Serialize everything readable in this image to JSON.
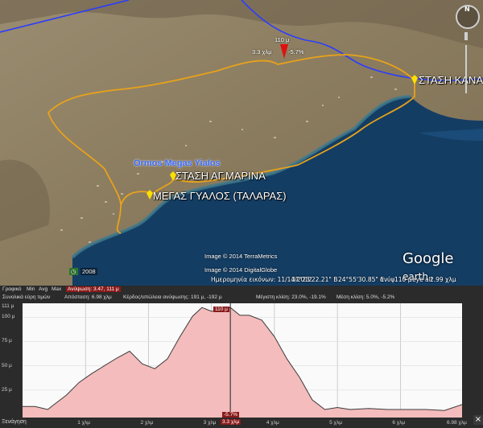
{
  "map": {
    "place_labels": {
      "kanala": "ΣΤΑΣΗ ΚΑΝΑ",
      "marina": "ΣΤΑΣΗ ΑΓ.ΜΑΡΙΝΑ",
      "megas": "ΜΕΓΑΣ ΓΥΑΛΟΣ (ΤΑΛΑΡΑΣ)",
      "ormos": "Ormos Megas Yialos"
    },
    "marker": {
      "elev": "110 μ",
      "dist": "3.3 χλμ",
      "slope": "-5.7%"
    },
    "copyright": [
      "Image © 2014 TerraMetrics",
      "Image © 2014 DigitalGlobe"
    ],
    "year_badge": "2008",
    "logo": {
      "brand": "Google",
      "suffix": "earth"
    },
    "status_bar": {
      "date": "Ημερομηνία εικόνων: 11/14/2012",
      "lat": "37°23'22.21\" Β",
      "lon": "24°55'30.85\" Ε",
      "alt_label": "ανύψ",
      "alt_value": "110 μ",
      "eye_label": "eye alt",
      "eye_value": "2.99 χλμ"
    },
    "colors": {
      "route": "#e8a21a",
      "river": "#2a3cff",
      "sea": "#123a5e",
      "land": "#8a7a60"
    }
  },
  "profile": {
    "toolbar1": {
      "graph": "Γραφικό",
      "min": "Min",
      "avg": "Avg",
      "max": "Max",
      "elevation": "Ανύψωση: 3.47, 111 μ"
    },
    "toolbar2": {
      "summary": "Συνολικά εύρη τιμών",
      "distance": "Απόσταση: 6.98 χλμ",
      "gain": "Κέρδος/απώλεια ανύψωσης: 191 μ, -192 μ",
      "max_slope": "Μέγιστη κλίση: 23.0%, -19.1%",
      "avg_slope": "Μέση κλίση: 5.0%, -5.2%"
    },
    "cursor": {
      "elev_tag": "110 μ",
      "slope_tag": "-5.7%",
      "dist_tag": "3.3 χλμ"
    },
    "footer_left": "Ξενάγηση",
    "close": "×"
  },
  "chart_data": {
    "type": "area",
    "title": "",
    "xlabel": "",
    "ylabel": "",
    "xlim": [
      0,
      6.98
    ],
    "ylim": [
      0,
      111
    ],
    "x_ticks": [
      "1 χλμ",
      "2 χλμ",
      "3 χλμ",
      "4 χλμ",
      "5 χλμ",
      "6 χλμ",
      "6.98 χλμ"
    ],
    "y_ticks": [
      "111 μ",
      "100 μ",
      "75 μ",
      "50 μ",
      "25 μ"
    ],
    "series": [
      {
        "x": [
          0,
          0.2,
          0.4,
          0.5,
          0.7,
          0.9,
          1.1,
          1.3,
          1.5,
          1.7,
          1.9,
          2.1,
          2.3,
          2.5,
          2.7,
          2.85,
          3.0,
          3.15,
          3.3,
          3.45,
          3.6,
          3.8,
          4.0,
          4.2,
          4.4,
          4.6,
          4.8,
          5.0,
          5.2,
          5.5,
          5.8,
          6.1,
          6.4,
          6.7,
          6.98
        ],
        "y": [
          8,
          8,
          5,
          10,
          20,
          33,
          42,
          50,
          58,
          65,
          52,
          47,
          57,
          80,
          101,
          110,
          106,
          108,
          110,
          102,
          102,
          97,
          80,
          57,
          38,
          15,
          5,
          7,
          5,
          6,
          5,
          5,
          5,
          4,
          10
        ]
      }
    ],
    "fill_color": "#f4bcbc",
    "line_color": "#3b3b3b",
    "cursor_x": 3.3,
    "grid": true
  }
}
